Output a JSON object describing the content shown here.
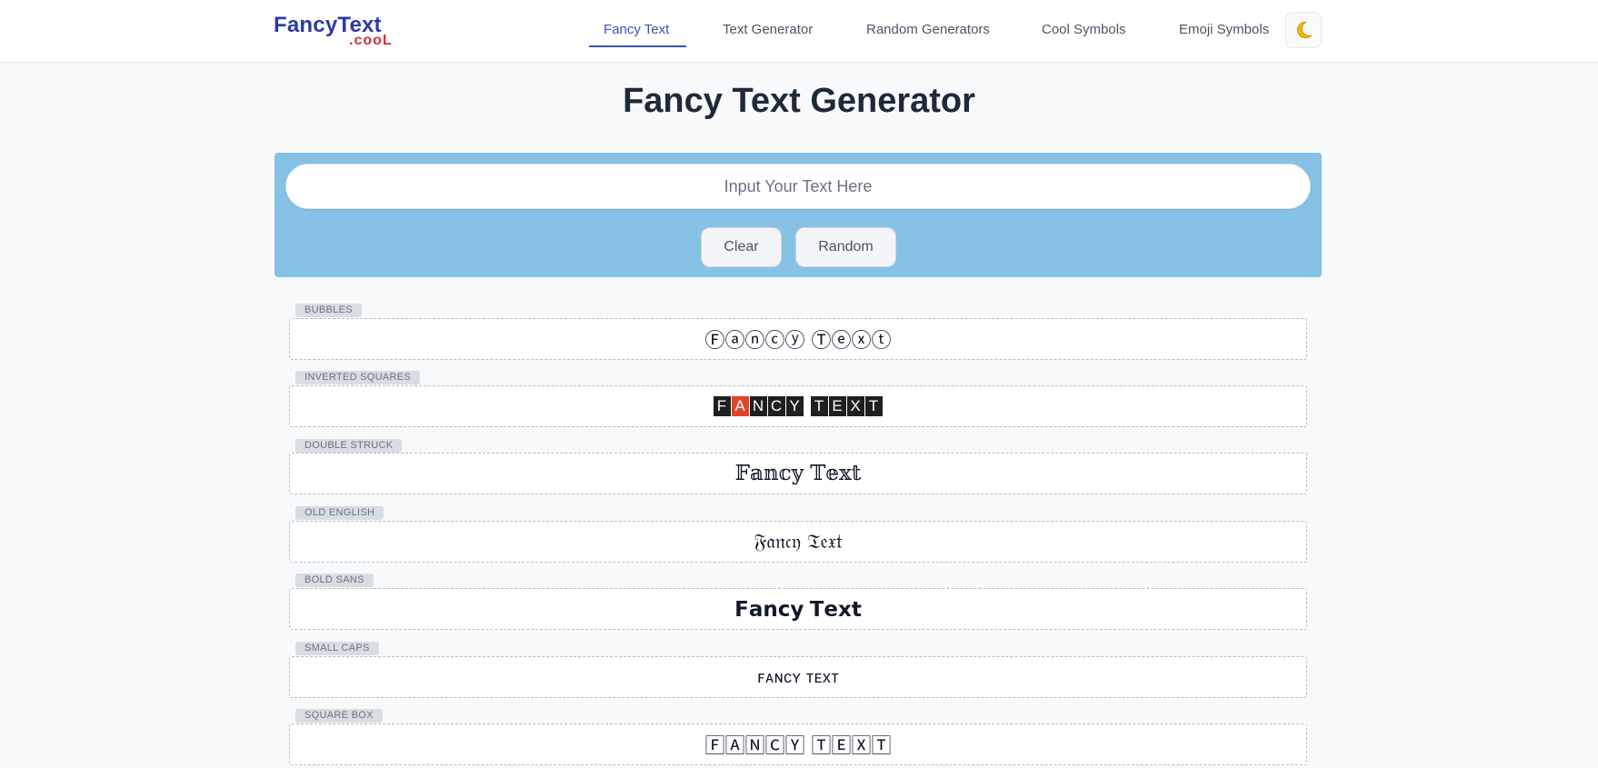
{
  "logo": {
    "main": "FancyText",
    "sub": ".cooL"
  },
  "nav": {
    "items": [
      {
        "label": "Fancy Text",
        "active": true
      },
      {
        "label": "Text Generator",
        "active": false
      },
      {
        "label": "Random Generators",
        "active": false
      },
      {
        "label": "Cool Symbols",
        "active": false
      },
      {
        "label": "Emoji Symbols",
        "active": false
      }
    ],
    "theme_icon": "moon-icon",
    "theme_glyph": "🌙"
  },
  "page": {
    "title": "Fancy Text Generator"
  },
  "input": {
    "placeholder": "Input Your Text Here",
    "value": ""
  },
  "buttons": {
    "clear": "Clear",
    "random": "Random"
  },
  "results": [
    {
      "tag": "BUBBLES",
      "text": "Ⓕⓐⓝⓒⓨ Ⓣⓔⓧⓣ"
    },
    {
      "tag": "INVERTED SQUARES",
      "text": "🅵🅰🅽🅲🆈 🆃🅴🆇🆃",
      "letters": [
        "F",
        "A",
        "N",
        "C",
        "Y",
        " ",
        "T",
        "E",
        "X",
        "T"
      ]
    },
    {
      "tag": "DOUBLE STRUCK",
      "text": "𝔽𝕒𝕟𝕔𝕪 𝕋𝕖𝕩𝕥"
    },
    {
      "tag": "OLD ENGLISH",
      "text": "𝔉𝔞𝔫𝔠𝔶 𝔗𝔢𝔵𝔱"
    },
    {
      "tag": "BOLD SANS",
      "text": "𝗙𝗮𝗻𝗰𝘆 𝗧𝗲𝘅𝘁"
    },
    {
      "tag": "SMALL CAPS",
      "text": "ꜰᴀɴᴄʏ ᴛᴇxᴛ"
    },
    {
      "tag": "SQUARE BOX",
      "text": "🄵🄰🄽🄲🅈 🅃🄴🅇🅃"
    }
  ],
  "colors": {
    "brand": "#2b3aa5",
    "accent": "#3f51b5",
    "panel": "#86c2e6",
    "highlight": "#e0432b"
  }
}
